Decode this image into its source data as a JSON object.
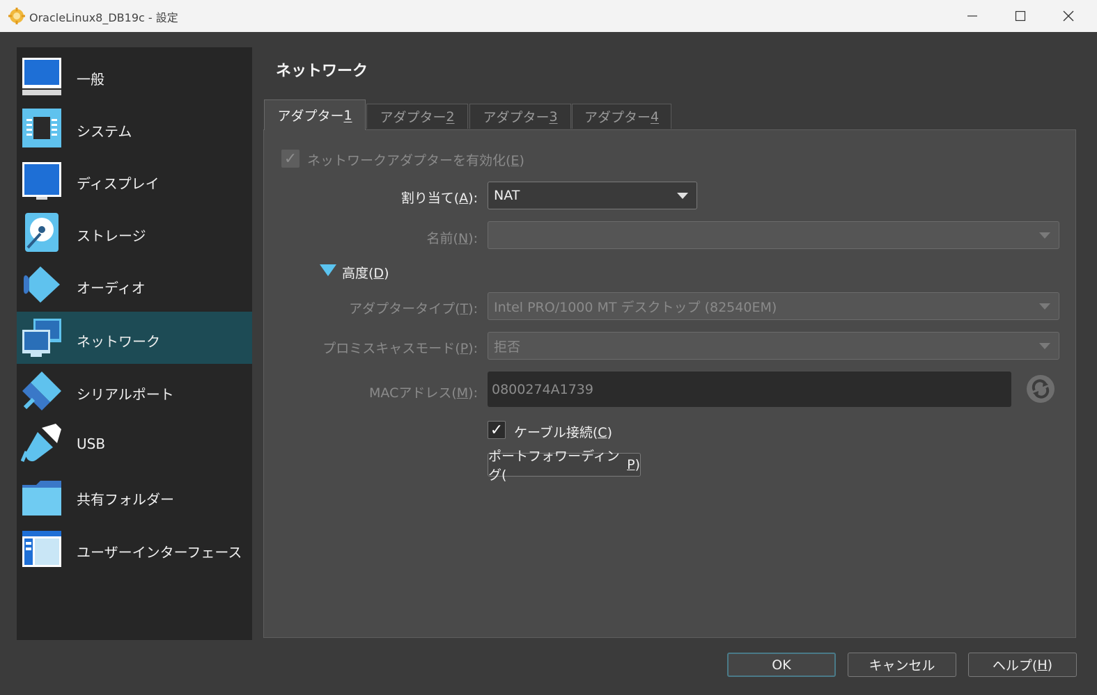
{
  "window": {
    "title": "OracleLinux8_DB19c - 設定"
  },
  "sidebar": {
    "items": [
      {
        "label": "一般",
        "icon": "general-monitor-icon"
      },
      {
        "label": "システム",
        "icon": "chip-icon"
      },
      {
        "label": "ディスプレイ",
        "icon": "monitor-icon"
      },
      {
        "label": "ストレージ",
        "icon": "disk-icon"
      },
      {
        "label": "オーディオ",
        "icon": "speaker-icon"
      },
      {
        "label": "ネットワーク",
        "icon": "network-icon",
        "selected": true
      },
      {
        "label": "シリアルポート",
        "icon": "serial-cable-icon"
      },
      {
        "label": "USB",
        "icon": "usb-icon"
      },
      {
        "label": "共有フォルダー",
        "icon": "folder-icon"
      },
      {
        "label": "ユーザーインターフェース",
        "icon": "window-layout-icon"
      }
    ]
  },
  "page": {
    "title": "ネットワーク"
  },
  "tabs": [
    {
      "text": "アダプター ",
      "key": "1",
      "active": true
    },
    {
      "text": "アダプター ",
      "key": "2"
    },
    {
      "text": "アダプター ",
      "key": "3"
    },
    {
      "text": "アダプター ",
      "key": "4"
    }
  ],
  "form": {
    "enable_adapter": {
      "label_pre": "ネットワークアダプターを有効化(",
      "key": "E",
      "label_post": ")",
      "checked": true
    },
    "attached_to": {
      "label_pre": "割り当て(",
      "key": "A",
      "label_post": "):",
      "value": "NAT"
    },
    "name": {
      "label_pre": "名前(",
      "key": "N",
      "label_post": "):",
      "value": ""
    },
    "advanced": {
      "label_pre": "高度(",
      "key": "D",
      "label_post": ")"
    },
    "adapter_type": {
      "label_pre": "アダプタータイプ(",
      "key": "T",
      "label_post": "):",
      "value": "Intel PRO/1000 MT デスクトップ (82540EM)"
    },
    "promiscuous": {
      "label_pre": "プロミスキャスモード(",
      "key": "P",
      "label_post": "):",
      "value": "拒否"
    },
    "mac": {
      "label_pre": "MACアドレス(",
      "key": "M",
      "label_post": "):",
      "value": "0800274A1739"
    },
    "cable": {
      "label_pre": "ケーブル接続(",
      "key": "C",
      "label_post": ")",
      "checked": true
    },
    "port_forwarding": {
      "label_pre": "ポートフォワーディング(",
      "key": "P",
      "label_post": ")"
    }
  },
  "footer": {
    "ok": "OK",
    "cancel": "キャンセル",
    "help": {
      "label_pre": "ヘルプ(",
      "key": "H",
      "label_post": ")"
    }
  },
  "colors": {
    "selected_item": "#1d4b55",
    "advanced_triangle": "#5bc4f0"
  }
}
